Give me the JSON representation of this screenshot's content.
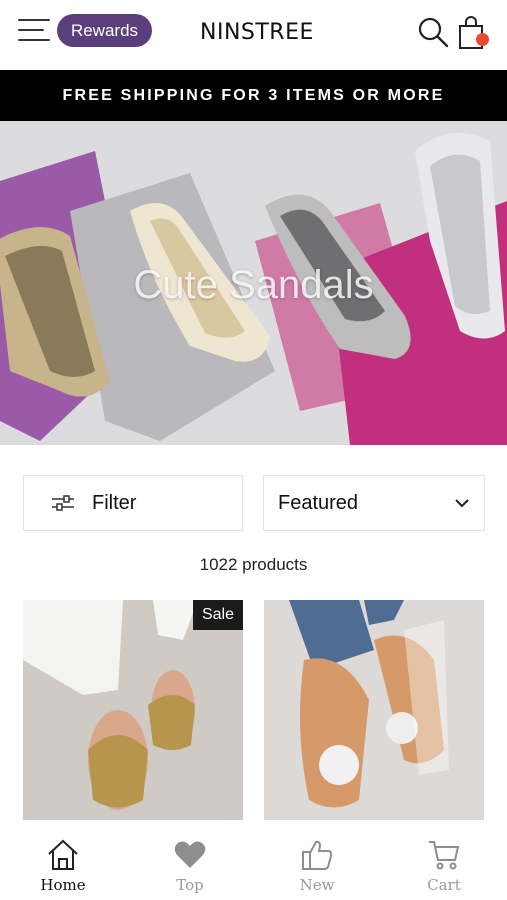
{
  "header": {
    "rewards_label": "Rewards",
    "logo_text": "NINSTREE",
    "cart_badge_color": "#e84a2e"
  },
  "banner": {
    "text": "FREE SHIPPING FOR 3 ITEMS OR MORE"
  },
  "hero": {
    "title": "Cute Sandals"
  },
  "controls": {
    "filter_label": "Filter",
    "sort_selected": "Featured"
  },
  "products": {
    "count_text": "1022 products",
    "items": [
      {
        "badge": "Sale"
      },
      {
        "badge": ""
      }
    ]
  },
  "bottom_nav": {
    "items": [
      {
        "label": "Home",
        "icon": "home-icon",
        "active": true
      },
      {
        "label": "Top",
        "icon": "heart-icon",
        "active": false
      },
      {
        "label": "New",
        "icon": "thumbs-up-icon",
        "active": false
      },
      {
        "label": "Cart",
        "icon": "cart-icon",
        "active": false
      }
    ]
  },
  "colors": {
    "rewards_bg": "#5b3f7c",
    "banner_bg": "#000000"
  }
}
